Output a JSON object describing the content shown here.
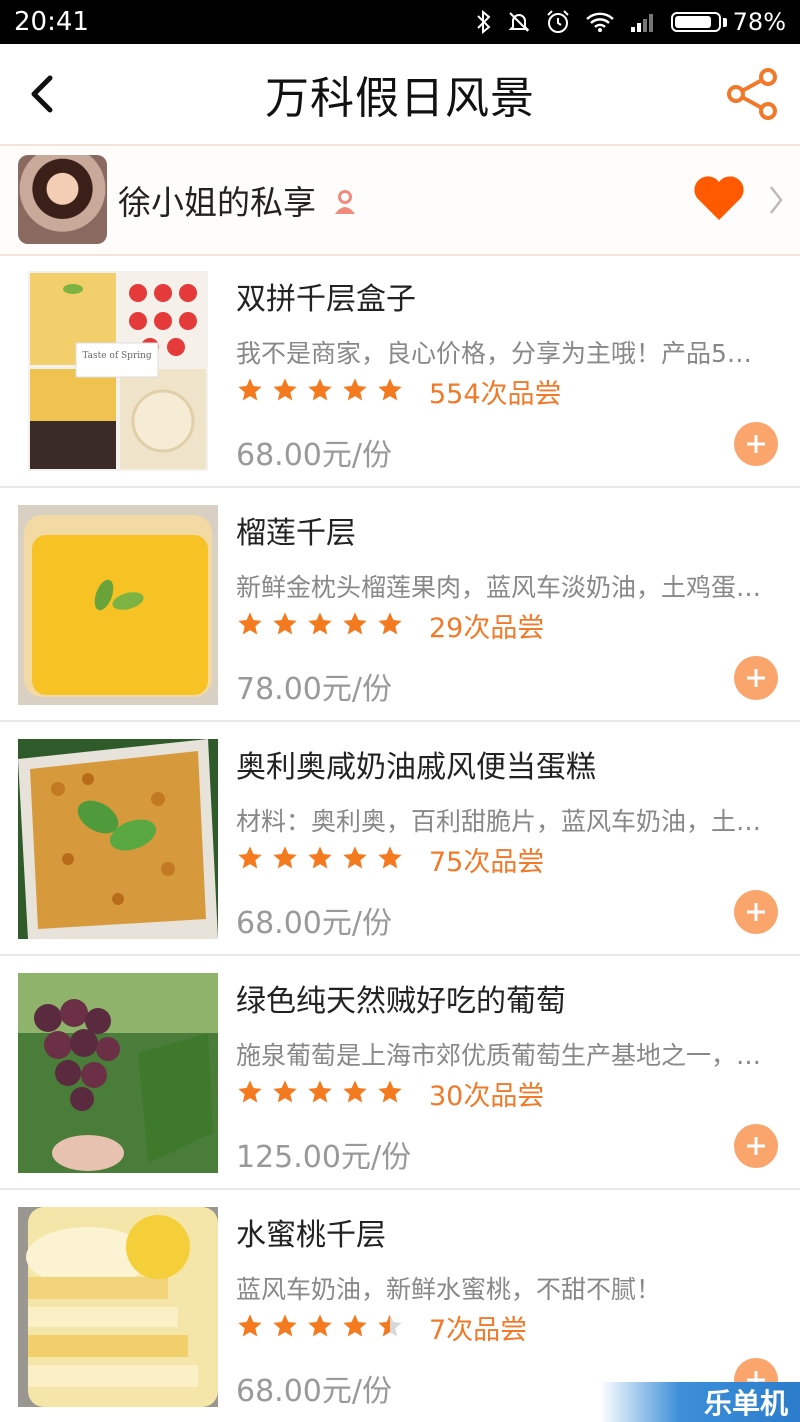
{
  "status_bar": {
    "time": "20:41",
    "battery": "78%",
    "battery_level": 0.78,
    "icons": [
      "bluetooth-icon",
      "mute-icon",
      "alarm-icon",
      "wifi-icon",
      "signal-icon",
      "battery-icon"
    ]
  },
  "header": {
    "title": "万科假日风景",
    "back_icon": "back-arrow-icon",
    "share_icon": "share-icon",
    "accent_color": "#f07a2a"
  },
  "author": {
    "name": "徐小姐的私享",
    "badge_icon": "female-user-icon",
    "like_icon": "heart-icon",
    "like_color": "#ff5a00"
  },
  "items": [
    {
      "name": "双拼千层盒子",
      "description": "我不是商家，良心价格，分享为主哦！产品5…",
      "rating": 5,
      "tried": "554次品尝",
      "price": "68.00元/份",
      "thumb_caption": "Taste of Spring"
    },
    {
      "name": "榴莲千层",
      "description": "新鲜金枕头榴莲果肉，蓝风车淡奶油，土鸡蛋…",
      "rating": 5,
      "tried": "29次品尝",
      "price": "78.00元/份"
    },
    {
      "name": "奥利奥咸奶油戚风便当蛋糕",
      "description": "材料：奥利奥，百利甜脆片，蓝风车奶油，土…",
      "rating": 5,
      "tried": "75次品尝",
      "price": "68.00元/份"
    },
    {
      "name": "绿色纯天然贼好吃的葡萄",
      "description": "施泉葡萄是上海市郊优质葡萄生产基地之一，…",
      "rating": 5,
      "tried": "30次品尝",
      "price": "125.00元/份"
    },
    {
      "name": "水蜜桃千层",
      "description": "蓝风车奶油，新鲜水蜜桃，不甜不腻！",
      "rating": 4.5,
      "tried": "7次品尝",
      "price": "68.00元/份"
    }
  ],
  "watermark": "乐单机"
}
